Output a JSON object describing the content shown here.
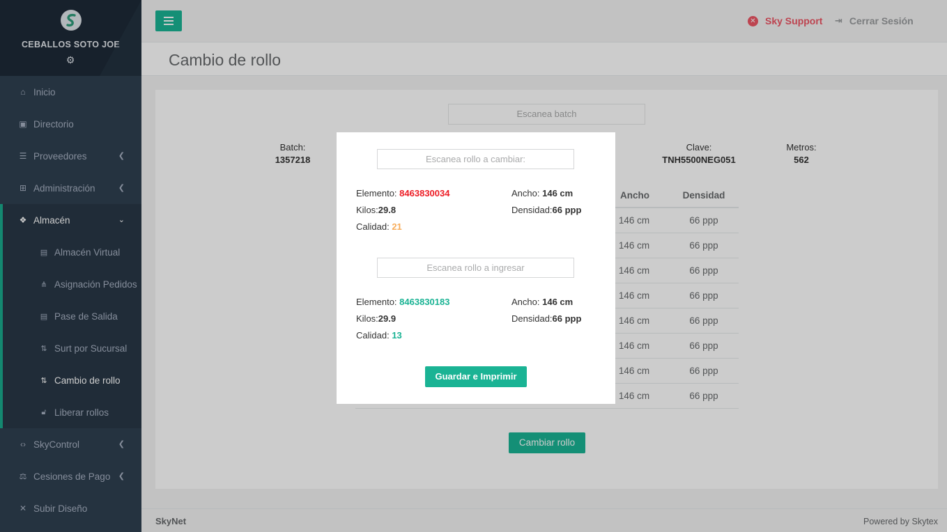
{
  "profile": {
    "name": "CEBALLOS SOTO JOE"
  },
  "nav": [
    {
      "label": "Inicio",
      "icon": "home-icon"
    },
    {
      "label": "Directorio",
      "icon": "contact-card-icon"
    },
    {
      "label": "Proveedores",
      "icon": "list-icon"
    },
    {
      "label": "Administración",
      "icon": "sitemap-icon"
    },
    {
      "label": "Almacén",
      "icon": "cubes-icon"
    }
  ],
  "submenu": [
    {
      "label": "Almacén Virtual",
      "icon": "file-icon"
    },
    {
      "label": "Asignación Pedidos",
      "icon": "hierarchy-icon"
    },
    {
      "label": "Pase de Salida",
      "icon": "file-text-icon"
    },
    {
      "label": "Surt por Sucursal",
      "icon": "sort-icon"
    },
    {
      "label": "Cambio de rollo",
      "icon": "swap-icon"
    },
    {
      "label": "Liberar rollos",
      "icon": "unlock-icon"
    }
  ],
  "nav_bottom": [
    {
      "label": "SkyControl",
      "icon": "code-icon"
    },
    {
      "label": "Cesiones de Pago",
      "icon": "balance-icon"
    },
    {
      "label": "Subir Diseño",
      "icon": "tools-icon"
    }
  ],
  "topbar": {
    "support": "Sky Support",
    "logout": "Cerrar Sesión"
  },
  "page": {
    "title": "Cambio de rollo"
  },
  "batch": {
    "placeholder": "Escanea batch",
    "batch_label": "Batch:",
    "batch_value": "1357218",
    "clave_label": "Clave:",
    "clave_value": "TNH5500NEG051",
    "metros_label": "Metros:",
    "metros_value": "562"
  },
  "table": {
    "headers": [
      "Ancho",
      "Densidad"
    ],
    "rows": [
      [
        "146 cm",
        "66 ppp"
      ],
      [
        "146 cm",
        "66 ppp"
      ],
      [
        "146 cm",
        "66 ppp"
      ],
      [
        "146 cm",
        "66 ppp"
      ],
      [
        "146 cm",
        "66 ppp"
      ],
      [
        "146 cm",
        "66 ppp"
      ],
      [
        "146 cm",
        "66 ppp"
      ],
      [
        "146 cm",
        "66 ppp"
      ]
    ]
  },
  "change_button": "Cambiar rollo",
  "footer": {
    "left": "SkyNet",
    "right": "Powered by Skytex"
  },
  "modal": {
    "out": {
      "placeholder": "Escanea rollo a cambiar:",
      "elemento_label": "Elemento:",
      "elemento": "8463830034",
      "ancho_label": "Ancho:",
      "ancho": "146 cm",
      "kilos_label": "Kilos:",
      "kilos": "29.8",
      "densidad_label": "Densidad:",
      "densidad": "66 ppp",
      "calidad_label": "Calidad:",
      "calidad": "21"
    },
    "in": {
      "placeholder": "Escanea rollo a ingresar",
      "elemento_label": "Elemento:",
      "elemento": "8463830183",
      "ancho_label": "Ancho:",
      "ancho": "146 cm",
      "kilos_label": "Kilos:",
      "kilos": "29.9",
      "densidad_label": "Densidad:",
      "densidad": "66 ppp",
      "calidad_label": "Calidad:",
      "calidad": "13"
    },
    "save_button": "Guardar e Imprimir"
  },
  "colors": {
    "accent": "#1ab394",
    "sidebar": "#2f4050",
    "danger": "#ed5565",
    "elemento_out": "#ed1c24",
    "calidad_out": "#f8ac59"
  }
}
